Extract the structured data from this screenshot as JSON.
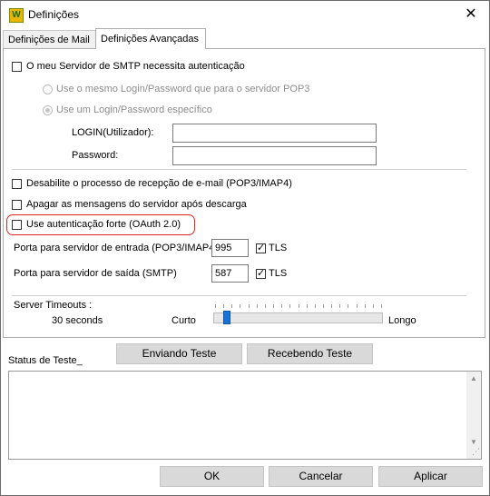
{
  "window": {
    "title": "Definições",
    "close_glyph": "✕",
    "icon_letter": "W"
  },
  "tabs": [
    {
      "label": "Definições de Mail",
      "active": false
    },
    {
      "label": "Definições Avançadas",
      "active": true
    }
  ],
  "auth": {
    "smtp_auth_label": "O meu Servidor de SMTP necessita autenticação",
    "smtp_auth_checked": false,
    "radio_same_label": "Use o mesmo Login/Password que para o servidor POP3",
    "radio_specific_label": "Use um Login/Password específico",
    "radio_selected": "specific",
    "login_label": "LOGIN(Utilizador):",
    "login_value": "",
    "password_label": "Password:",
    "password_value": ""
  },
  "options": {
    "disable_receive_label": "Desabilite o processo de recepção de e-mail (POP3/IMAP4)",
    "disable_receive_checked": false,
    "delete_after_label": "Apagar as mensagens do servidor após descarga",
    "delete_after_checked": false,
    "oauth_label": "Use autenticação forte (OAuth 2.0)",
    "oauth_checked": false
  },
  "ports": {
    "incoming_label": "Porta para servidor de entrada (POP3/IMAP4)",
    "incoming_value": "995",
    "incoming_tls_label": "TLS",
    "incoming_tls_checked": true,
    "outgoing_label": "Porta para servidor de saída (SMTP)",
    "outgoing_value": "587",
    "outgoing_tls_label": "TLS",
    "outgoing_tls_checked": true
  },
  "timeouts": {
    "section_label": "Server Timeouts :",
    "value_text": "30 seconds",
    "min_label": "Curto",
    "max_label": "Longo",
    "slider_level": 0.05
  },
  "test": {
    "status_label": "Status de Teste_",
    "send_button": "Enviando Teste",
    "receive_button": "Recebendo Teste",
    "status_text": ""
  },
  "footer": {
    "ok": "OK",
    "cancel": "Cancelar",
    "apply": "Aplicar"
  }
}
